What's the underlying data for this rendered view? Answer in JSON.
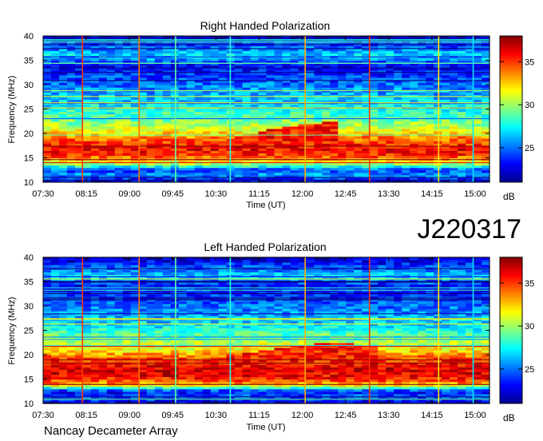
{
  "header": {
    "id_label": "J220317"
  },
  "footer": {
    "credit": "Nancay Decameter Array"
  },
  "colorbar": {
    "unit": "dB",
    "ticks": [
      25,
      30,
      35
    ],
    "range": [
      21,
      38
    ]
  },
  "chart_data": [
    {
      "type": "heatmap",
      "title": "Right Handed Polarization",
      "xlabel": "Time (UT)",
      "ylabel": "Frequency (MHz)",
      "x_ticks": [
        "07:30",
        "08:15",
        "09:00",
        "09:45",
        "10:30",
        "11:15",
        "12:00",
        "12:45",
        "13:30",
        "14:15",
        "15:00"
      ],
      "y_ticks": [
        10,
        15,
        20,
        25,
        30,
        35,
        40
      ],
      "xlim_minutes_ut": [
        450,
        915
      ],
      "ylim": [
        10,
        40
      ],
      "colorbar_unit": "dB",
      "colorbar_ticks": [
        25,
        30,
        35
      ],
      "colorbar_range": [
        21,
        38
      ],
      "intensity_profile_db": [
        {
          "freq_mhz": 10,
          "db": 22
        },
        {
          "freq_mhz": 11.5,
          "db": 26
        },
        {
          "freq_mhz": 12.5,
          "db": 24
        },
        {
          "freq_mhz": 14,
          "db": 31
        },
        {
          "freq_mhz": 15.5,
          "db": 35
        },
        {
          "freq_mhz": 17,
          "db": 36
        },
        {
          "freq_mhz": 19,
          "db": 34
        },
        {
          "freq_mhz": 21,
          "db": 31
        },
        {
          "freq_mhz": 23,
          "db": 29
        },
        {
          "freq_mhz": 26,
          "db": 27
        },
        {
          "freq_mhz": 30,
          "db": 25
        },
        {
          "freq_mhz": 34,
          "db": 23
        },
        {
          "freq_mhz": 36,
          "db": 27
        },
        {
          "freq_mhz": 40,
          "db": 22
        }
      ],
      "drift_feature": [
        {
          "time_min": 620,
          "freq_mhz": 18
        },
        {
          "time_min": 660,
          "freq_mhz": 19.5
        },
        {
          "time_min": 690,
          "freq_mhz": 21
        },
        {
          "time_min": 720,
          "freq_mhz": 22
        },
        {
          "time_min": 760,
          "freq_mhz": 22.5
        }
      ],
      "vertical_lines_min": [
        {
          "time_min": 491,
          "db": 35
        },
        {
          "time_min": 550,
          "db": 34
        },
        {
          "time_min": 588,
          "db": 29
        },
        {
          "time_min": 645,
          "db": 28
        },
        {
          "time_min": 723,
          "db": 33
        },
        {
          "time_min": 790,
          "db": 35
        },
        {
          "time_min": 862,
          "db": 32
        },
        {
          "time_min": 898,
          "db": 27
        }
      ]
    },
    {
      "type": "heatmap",
      "title": "Left Handed Polarization",
      "xlabel": "Time (UT)",
      "ylabel": "Frequency (MHz)",
      "x_ticks": [
        "07:30",
        "08:15",
        "09:00",
        "09:45",
        "10:30",
        "11:15",
        "12:00",
        "12:45",
        "13:30",
        "14:15",
        "15:00"
      ],
      "y_ticks": [
        10,
        15,
        20,
        25,
        30,
        35,
        40
      ],
      "xlim_minutes_ut": [
        450,
        915
      ],
      "ylim": [
        10,
        40
      ],
      "colorbar_unit": "dB",
      "colorbar_ticks": [
        25,
        30,
        35
      ],
      "colorbar_range": [
        21,
        38
      ],
      "intensity_profile_db": [
        {
          "freq_mhz": 10,
          "db": 22
        },
        {
          "freq_mhz": 11.5,
          "db": 25
        },
        {
          "freq_mhz": 12.5,
          "db": 23
        },
        {
          "freq_mhz": 14,
          "db": 33
        },
        {
          "freq_mhz": 15.5,
          "db": 36
        },
        {
          "freq_mhz": 17,
          "db": 36.5
        },
        {
          "freq_mhz": 19,
          "db": 35
        },
        {
          "freq_mhz": 21,
          "db": 32
        },
        {
          "freq_mhz": 23,
          "db": 30
        },
        {
          "freq_mhz": 26,
          "db": 27
        },
        {
          "freq_mhz": 30,
          "db": 25
        },
        {
          "freq_mhz": 34,
          "db": 23
        },
        {
          "freq_mhz": 36,
          "db": 27
        },
        {
          "freq_mhz": 40,
          "db": 22
        }
      ],
      "drift_feature": [
        {
          "time_min": 600,
          "freq_mhz": 18.5
        },
        {
          "time_min": 650,
          "freq_mhz": 20
        },
        {
          "time_min": 700,
          "freq_mhz": 21.5
        },
        {
          "time_min": 740,
          "freq_mhz": 22.5
        },
        {
          "time_min": 800,
          "freq_mhz": 22
        }
      ],
      "vertical_lines_min": [
        {
          "time_min": 491,
          "db": 35
        },
        {
          "time_min": 550,
          "db": 34
        },
        {
          "time_min": 588,
          "db": 29
        },
        {
          "time_min": 645,
          "db": 28
        },
        {
          "time_min": 723,
          "db": 33
        },
        {
          "time_min": 790,
          "db": 35
        },
        {
          "time_min": 862,
          "db": 32
        },
        {
          "time_min": 898,
          "db": 27
        }
      ]
    }
  ]
}
